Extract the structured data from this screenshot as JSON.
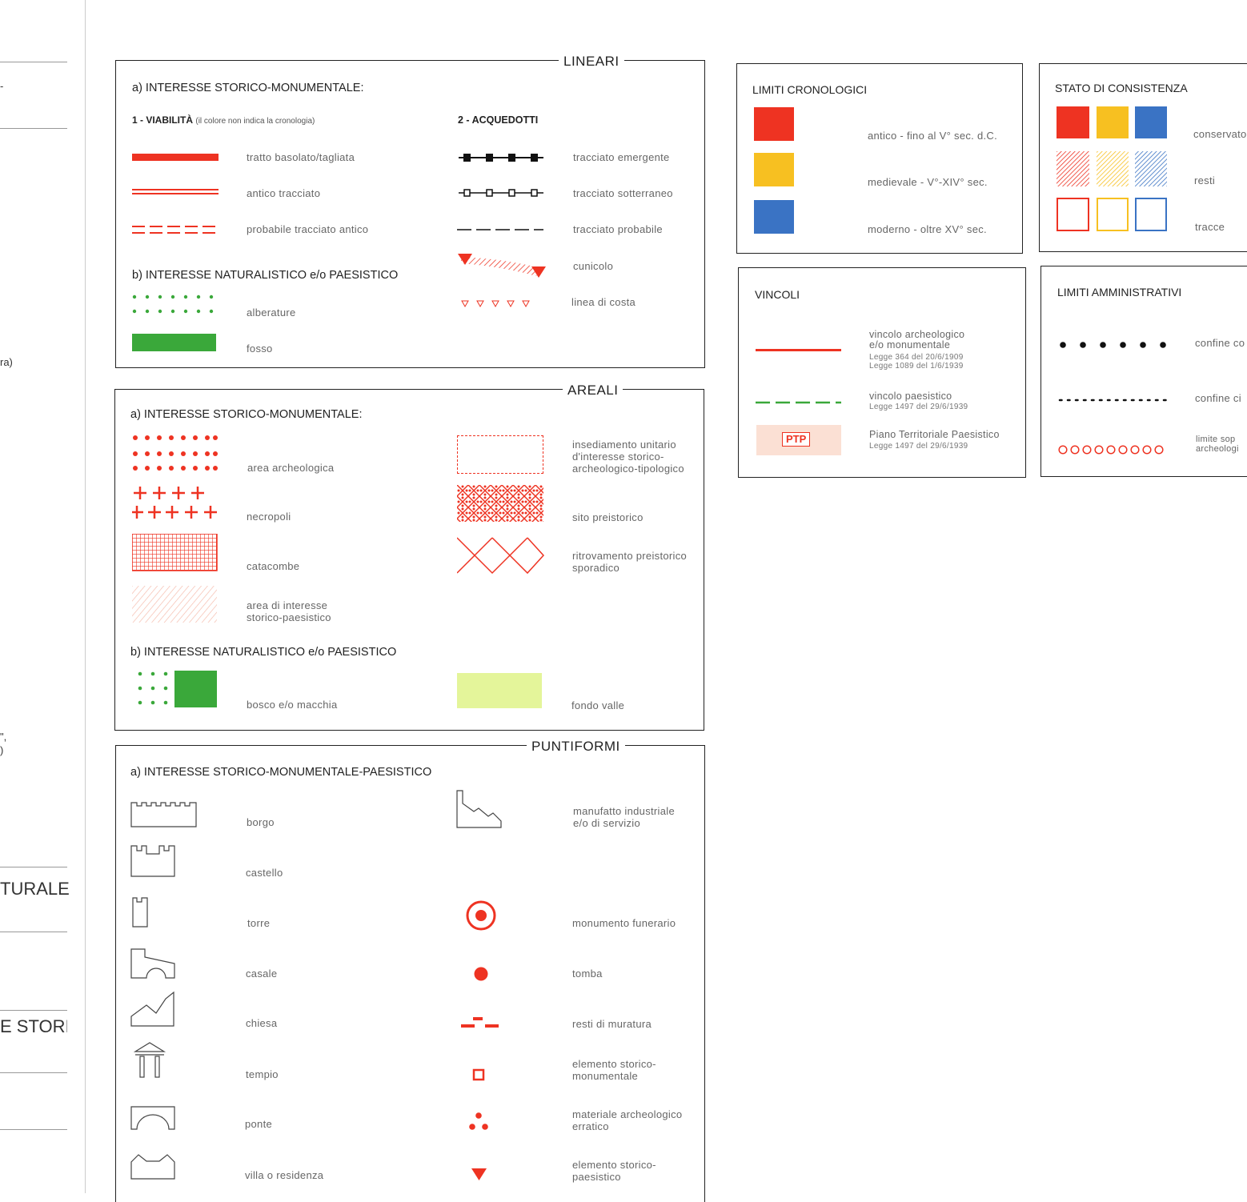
{
  "left_strip": {
    "fragments": [
      "-",
      "ra)",
      "\",",
      ")",
      "TURALE",
      "E STORI("
    ]
  },
  "lineari": {
    "title": "LINEARI",
    "a_heading": "a) INTERESSE STORICO-MONUMENTALE:",
    "viabilita_heading": "1 - VIABILITÀ",
    "viabilita_note": "(il colore non indica la cronologia)",
    "acquedotti_heading": "2 - ACQUEDOTTI",
    "viabilita_items": [
      "tratto basolato/tagliata",
      "antico tracciato",
      "probabile tracciato antico"
    ],
    "acquedotti_items": [
      "tracciato emergente",
      "tracciato sotterraneo",
      "tracciato probabile",
      "cunicolo",
      "linea di costa"
    ],
    "b_heading": "b) INTERESSE NATURALISTICO e/o PAESISTICO",
    "b_items": [
      "alberature",
      "fosso"
    ]
  },
  "areali": {
    "title": "AREALI",
    "a_heading": "a) INTERESSE STORICO-MONUMENTALE:",
    "left_items": [
      "area archeologica",
      "necropoli",
      "catacombe",
      "area di interesse\nstorico-paesistico"
    ],
    "right_items": [
      "insediamento unitario\nd'interesse storico-\narcheologico-tipologico",
      "sito preistorico",
      "ritrovamento preistorico\nsporadico"
    ],
    "b_heading": "b) INTERESSE NATURALISTICO e/o PAESISTICO",
    "b_items": [
      "bosco e/o macchia",
      "fondo valle"
    ]
  },
  "puntiformi": {
    "title": "PUNTIFORMI",
    "a_heading": "a) INTERESSE STORICO-MONUMENTALE-PAESISTICO",
    "left_items": [
      "borgo",
      "castello",
      "torre",
      "casale",
      "chiesa",
      "tempio",
      "ponte",
      "villa o residenza"
    ],
    "right_items": [
      "manufatto industriale\ne/o di servizio",
      "monumento funerario",
      "tomba",
      "resti di muratura",
      "elemento storico-\nmonumentale",
      "materiale archeologico\nerratico",
      "elemento storico-\npaesistico"
    ]
  },
  "limiti_cronologici": {
    "title": "LIMITI CRONOLOGICI",
    "items": [
      "antico - fino al V° sec. d.C.",
      "medievale - V°-XIV° sec.",
      "moderno - oltre XV° sec."
    ]
  },
  "stato_consistenza": {
    "title": "STATO DI CONSISTENZA",
    "items": [
      "conservato",
      "resti",
      "tracce"
    ]
  },
  "vincoli": {
    "title": "VINCOLI",
    "items": [
      {
        "main": "vincolo archeologico\ne/o monumentale",
        "sub": "Legge 364 del 20/6/1909\nLegge 1089 del 1/6/1939"
      },
      {
        "main": "vincolo paesistico",
        "sub": "Legge 1497 del 29/6/1939"
      },
      {
        "main": "Piano Territoriale Paesistico",
        "sub": "Legge 1497 del 29/6/1939"
      }
    ],
    "ptp_label": "PTP"
  },
  "limiti_amministrativi": {
    "title": "LIMITI AMMINISTRATIVI",
    "items": [
      "confine co",
      "confine ci",
      "limite sop\narcheologi"
    ]
  },
  "colors": {
    "red": "#ee3322",
    "yellow": "#f7c021",
    "blue": "#3a73c4",
    "green": "#3aa83a",
    "lightgreen": "#e4f59a",
    "pink": "#fbe0d4"
  }
}
